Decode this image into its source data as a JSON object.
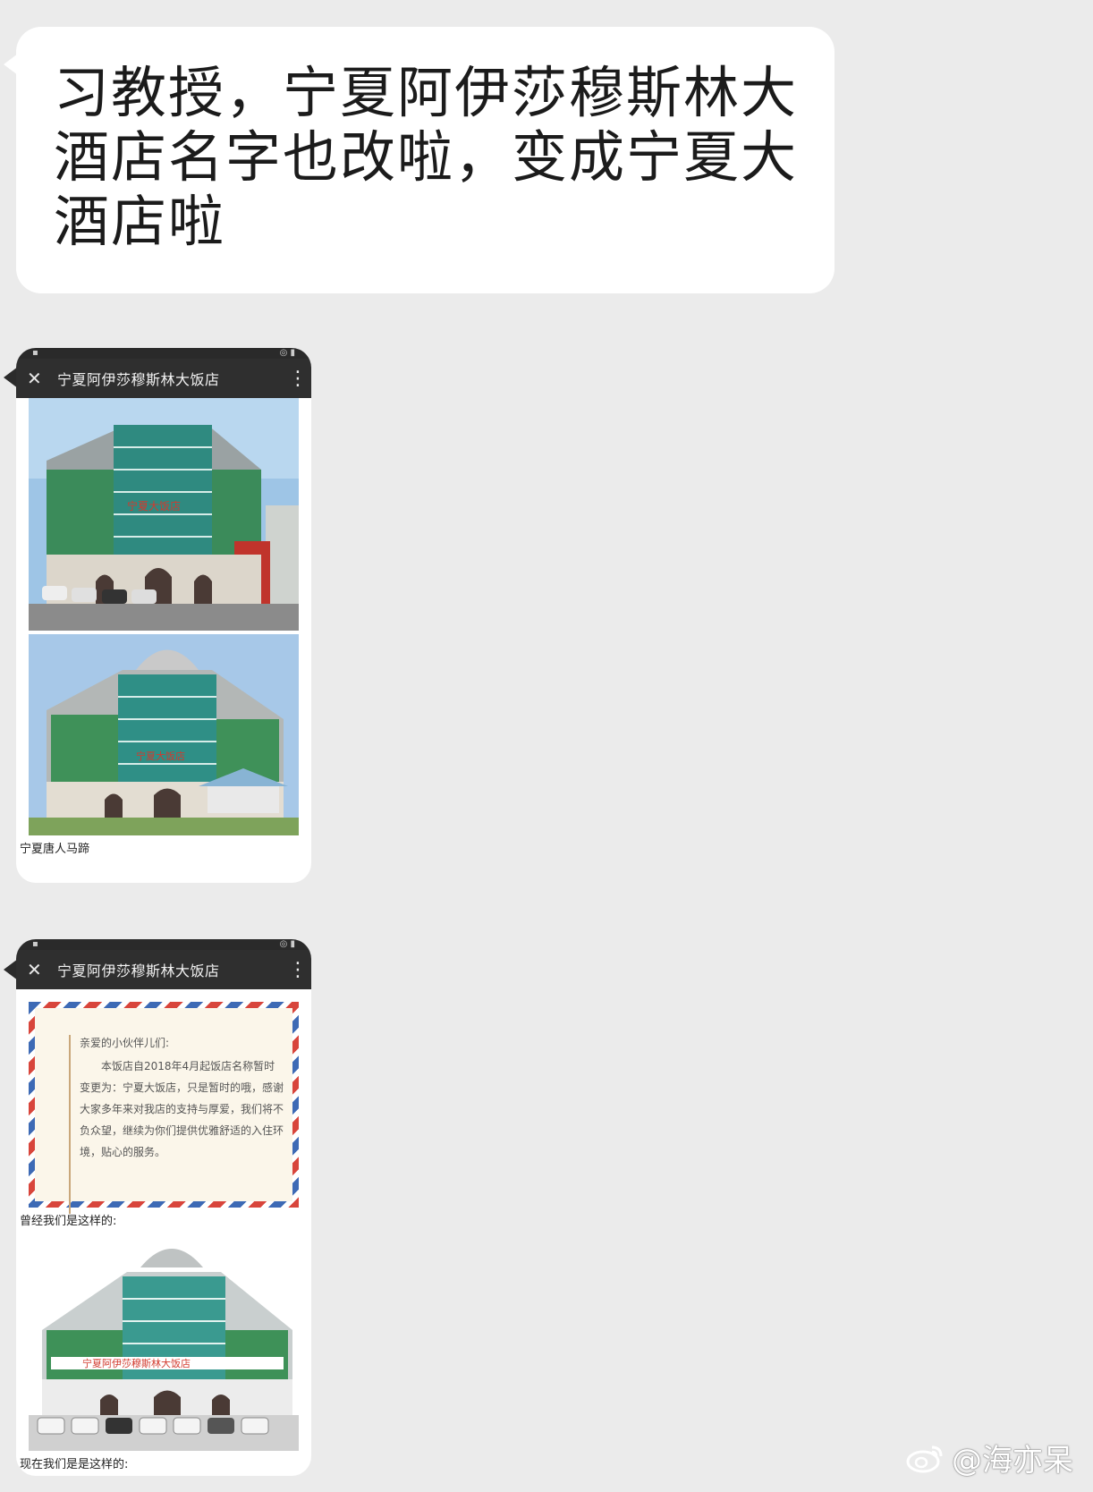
{
  "message": {
    "text": "习教授，宁夏阿伊莎穆斯林大酒店名字也改啦，变成宁夏大酒店啦"
  },
  "screenshot1": {
    "title": "宁夏阿伊莎穆斯林大饭店",
    "caption": "宁夏唐人马蹄"
  },
  "screenshot2": {
    "title": "宁夏阿伊莎穆斯林大饭店",
    "notice_greeting": "亲爱的小伙伴儿们:",
    "notice_body": "本饭店自2018年4月起饭店名称暂时变更为：宁夏大饭店，只是暂时的哦，感谢大家多年来对我店的支持与厚爱，我们将不负众望，继续为你们提供优雅舒适的入住环境，贴心的服务。",
    "caption_top": "曾经我们是这样的:",
    "caption_bottom": "现在我们是是这样的:"
  },
  "watermark": {
    "text": "@海亦呆",
    "icon": "weibo-icon"
  },
  "colors": {
    "background": "#ebebeb",
    "bubble": "#ffffff",
    "titlebar": "#2f2f2f"
  }
}
